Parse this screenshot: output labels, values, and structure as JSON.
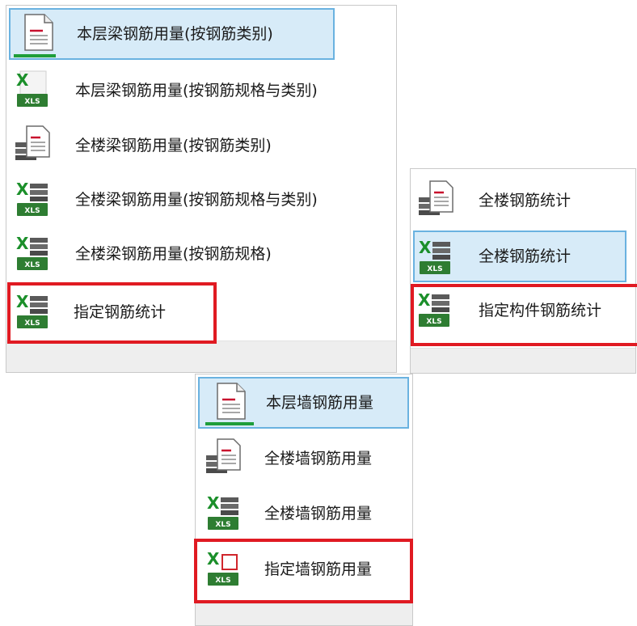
{
  "colors": {
    "selection_bg": "#d7ebf8",
    "selection_border": "#6ab2e0",
    "highlight_border": "#e01a22",
    "excel_green": "#1e7e34",
    "accent_underline": "#1e9e3a"
  },
  "beam_menu": {
    "items": [
      {
        "label": "本层梁钢筋用量(按钢筋类别)",
        "icon": "document-report-icon",
        "selected": true
      },
      {
        "label": "本层梁钢筋用量(按钢筋规格与类别)",
        "icon": "excel-xls-icon"
      },
      {
        "label": "全楼梁钢筋用量(按钢筋类别)",
        "icon": "document-stack-icon"
      },
      {
        "label": "全楼梁钢筋用量(按钢筋规格与类别)",
        "icon": "excel-stack-icon"
      },
      {
        "label": "全楼梁钢筋用量(按钢筋规格)",
        "icon": "excel-stack-icon"
      },
      {
        "label": "指定钢筋统计",
        "icon": "excel-stack-icon",
        "highlighted": true
      }
    ]
  },
  "rebar_menu": {
    "items": [
      {
        "label": "全楼钢筋统计",
        "icon": "document-stack-icon"
      },
      {
        "label": "全楼钢筋统计",
        "icon": "excel-stack-icon",
        "selected": true
      },
      {
        "label": "指定构件钢筋统计",
        "icon": "excel-stack-icon",
        "highlighted": true
      }
    ]
  },
  "wall_menu": {
    "items": [
      {
        "label": "本层墙钢筋用量",
        "icon": "document-report-icon",
        "selected": true
      },
      {
        "label": "全楼墙钢筋用量",
        "icon": "document-stack-icon"
      },
      {
        "label": "全楼墙钢筋用量",
        "icon": "excel-stack-icon"
      },
      {
        "label": "指定墙钢筋用量",
        "icon": "excel-box-icon",
        "highlighted": true
      }
    ]
  }
}
